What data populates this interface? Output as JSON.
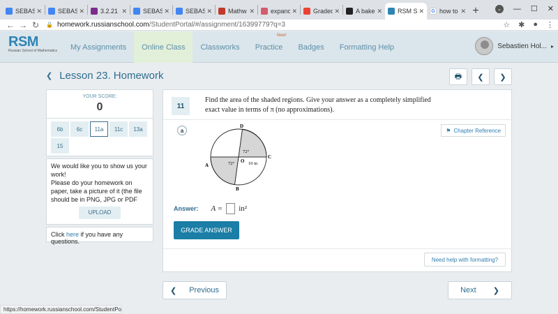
{
  "browser": {
    "tabs": [
      {
        "label": "SEBAS",
        "icon": "docs-icon",
        "color": "#4285f4"
      },
      {
        "label": "SEBAS",
        "icon": "docs-icon",
        "color": "#4285f4"
      },
      {
        "label": "3.2.21",
        "icon": "classroom-icon",
        "color": "#7b2c8c"
      },
      {
        "label": "SEBAS",
        "icon": "docs-icon",
        "color": "#4285f4"
      },
      {
        "label": "SEBAS",
        "icon": "docs-icon",
        "color": "#4285f4"
      },
      {
        "label": "Mathw",
        "icon": "mathway-icon",
        "color": "#c0392b"
      },
      {
        "label": "expanc",
        "icon": "symbolab-icon",
        "color": "#d35b6d"
      },
      {
        "label": "Graded",
        "icon": "gmail-icon",
        "color": "#ea4335"
      },
      {
        "label": "A bake",
        "icon": "brainly-icon",
        "color": "#222222"
      },
      {
        "label": "RSM St",
        "icon": "rsm-icon",
        "color": "#2f84b4",
        "active": true
      },
      {
        "label": "how to",
        "icon": "google-icon",
        "color": "#ffffff"
      }
    ],
    "url_host": "homework.russianschool.com",
    "url_path": "/StudentPortal/#/assignment/16399779?q=3",
    "status_url": "https://homework.russianschool.com/StudentPortal/"
  },
  "header": {
    "logo_text": "RSM",
    "logo_sub": "Russian School of Mathematics",
    "nav": [
      {
        "label": "My Assignments"
      },
      {
        "label": "Online Class",
        "active": true
      },
      {
        "label": "Classworks"
      },
      {
        "label": "Practice",
        "badge": "New!"
      },
      {
        "label": "Badges"
      },
      {
        "label": "Formatting Help"
      }
    ],
    "user_name": "Sebastien Hol..."
  },
  "lesson": {
    "title": "Lesson 23. Homework"
  },
  "score": {
    "label": "YOUR SCORE:",
    "value": "0"
  },
  "problems": [
    "6b",
    "6c",
    "11a",
    "11c",
    "13a",
    "15"
  ],
  "active_problem": "11a",
  "photo_prompt": "We would like you to show us your work!\nPlease do your homework on paper, take a picture of it (the file should be in PNG, JPG or PDF format), and",
  "upload_label": "UPLOAD",
  "help": {
    "prefix": "Click ",
    "link": "here",
    "suffix": " if you have any questions."
  },
  "question": {
    "number": "11",
    "text": "Find the area of the shaded regions. Give your answer as a completely simplified exact value  in terms of π (no approximations).",
    "part": "a",
    "chapter_ref": "Chapter Reference",
    "diagram": {
      "labels": {
        "D": "D",
        "C": "C",
        "A": "A",
        "B": "B",
        "O": "O"
      },
      "angle_top": "72°",
      "angle_bottom": "72°",
      "radius_label": "10 in"
    },
    "answer_label": "Answer:",
    "answer_var": "A =",
    "answer_unit": "in²",
    "grade_button": "GRADE ANSWER",
    "need_help": "Need help with formatting?"
  },
  "footer_nav": {
    "previous": "Previous",
    "next": "Next"
  }
}
